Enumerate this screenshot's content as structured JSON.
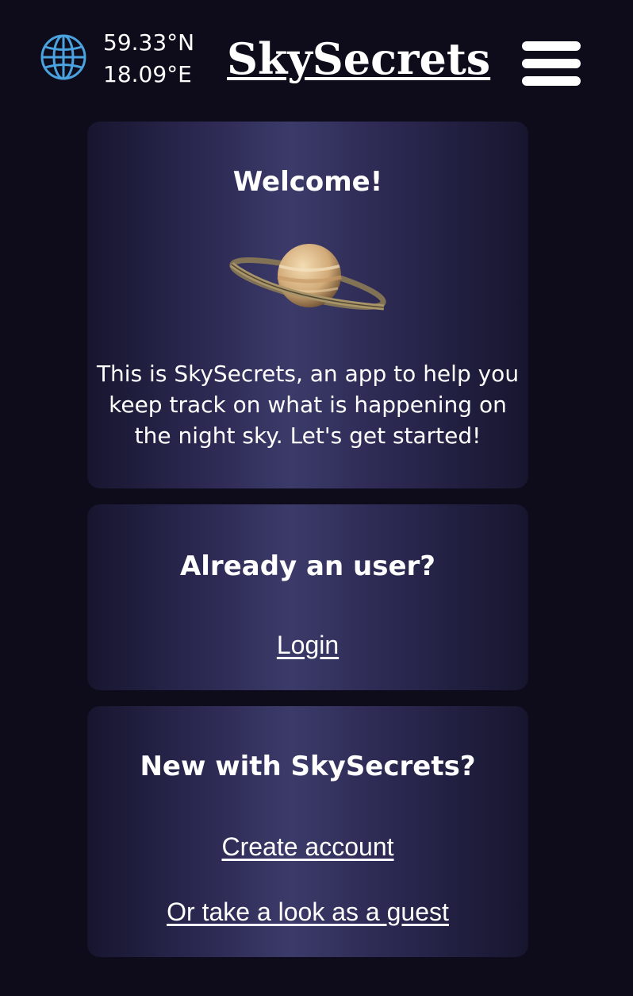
{
  "header": {
    "globe_icon": "globe-icon",
    "latitude": "59.33°N",
    "longitude": "18.09°E",
    "app_title": "SkySecrets",
    "menu_icon": "hamburger-menu-icon"
  },
  "welcome_card": {
    "title": "Welcome!",
    "image": "saturn-planet-image",
    "description": "This is SkySecrets, an app to help you keep track on what is happening on the night sky. Let's get started!"
  },
  "login_card": {
    "title": "Already an user?",
    "login_link": "Login"
  },
  "signup_card": {
    "title": "New with SkySecrets?",
    "create_account_link": "Create account",
    "guest_link": "Or take a look as a guest"
  },
  "colors": {
    "background": "#0e0c1b",
    "card_center": "#3c3a69",
    "globe": "#4aa3df",
    "text": "#ffffff"
  }
}
